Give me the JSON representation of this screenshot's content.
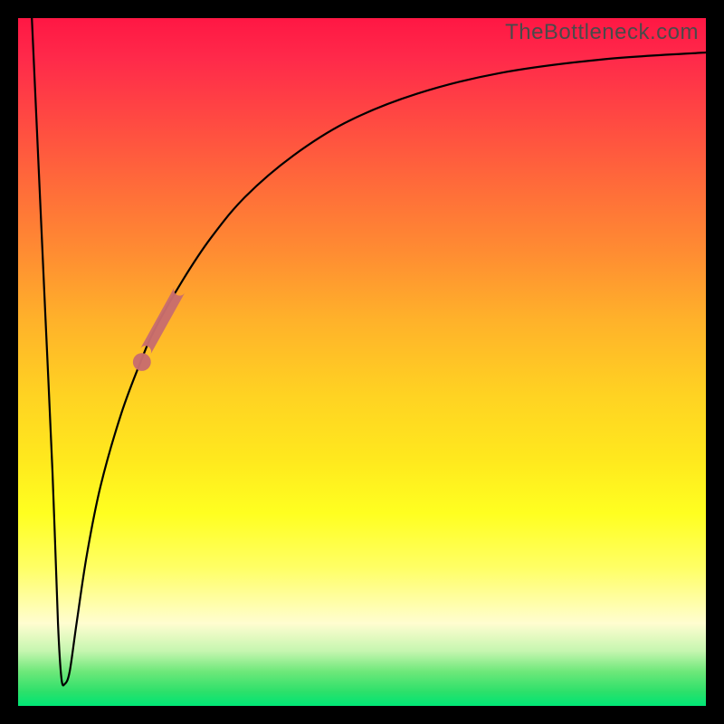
{
  "watermark": "TheBottleneck.com",
  "chart_data": {
    "type": "line",
    "title": "",
    "xlabel": "",
    "ylabel": "",
    "x_range": [
      0,
      100
    ],
    "y_range": [
      0,
      100
    ],
    "description": "Bottleneck percentage curve: steep dip to near-zero at a low x value then asymptotic rise toward 100.",
    "curve_points": [
      {
        "x": 2.0,
        "y": 100.0
      },
      {
        "x": 3.0,
        "y": 78.0
      },
      {
        "x": 4.0,
        "y": 56.0
      },
      {
        "x": 5.0,
        "y": 34.0
      },
      {
        "x": 5.8,
        "y": 12.0
      },
      {
        "x": 6.3,
        "y": 4.0
      },
      {
        "x": 6.8,
        "y": 3.2
      },
      {
        "x": 7.5,
        "y": 5.0
      },
      {
        "x": 8.5,
        "y": 12.0
      },
      {
        "x": 10.0,
        "y": 22.0
      },
      {
        "x": 12.0,
        "y": 32.0
      },
      {
        "x": 15.0,
        "y": 42.5
      },
      {
        "x": 18.0,
        "y": 50.5
      },
      {
        "x": 20.0,
        "y": 55.0
      },
      {
        "x": 24.0,
        "y": 62.0
      },
      {
        "x": 28.0,
        "y": 68.0
      },
      {
        "x": 33.0,
        "y": 74.0
      },
      {
        "x": 40.0,
        "y": 80.0
      },
      {
        "x": 48.0,
        "y": 85.0
      },
      {
        "x": 58.0,
        "y": 89.0
      },
      {
        "x": 70.0,
        "y": 92.0
      },
      {
        "x": 85.0,
        "y": 94.0
      },
      {
        "x": 100.0,
        "y": 95.0
      }
    ],
    "highlight_main": {
      "x0": 18.5,
      "y0": 51.5,
      "x1": 23.5,
      "y1": 60.5,
      "color": "#c86d6d"
    },
    "highlight_dot": {
      "x": 18.0,
      "y": 50.0,
      "r": 1.3,
      "color": "#c86d6d"
    },
    "background_gradient": {
      "stops": [
        {
          "pos": 0.0,
          "color": "#ff1744"
        },
        {
          "pos": 0.5,
          "color": "#ffd322"
        },
        {
          "pos": 0.8,
          "color": "#ffff66"
        },
        {
          "pos": 1.0,
          "color": "#00e676"
        }
      ],
      "direction": "top-to-bottom"
    }
  }
}
